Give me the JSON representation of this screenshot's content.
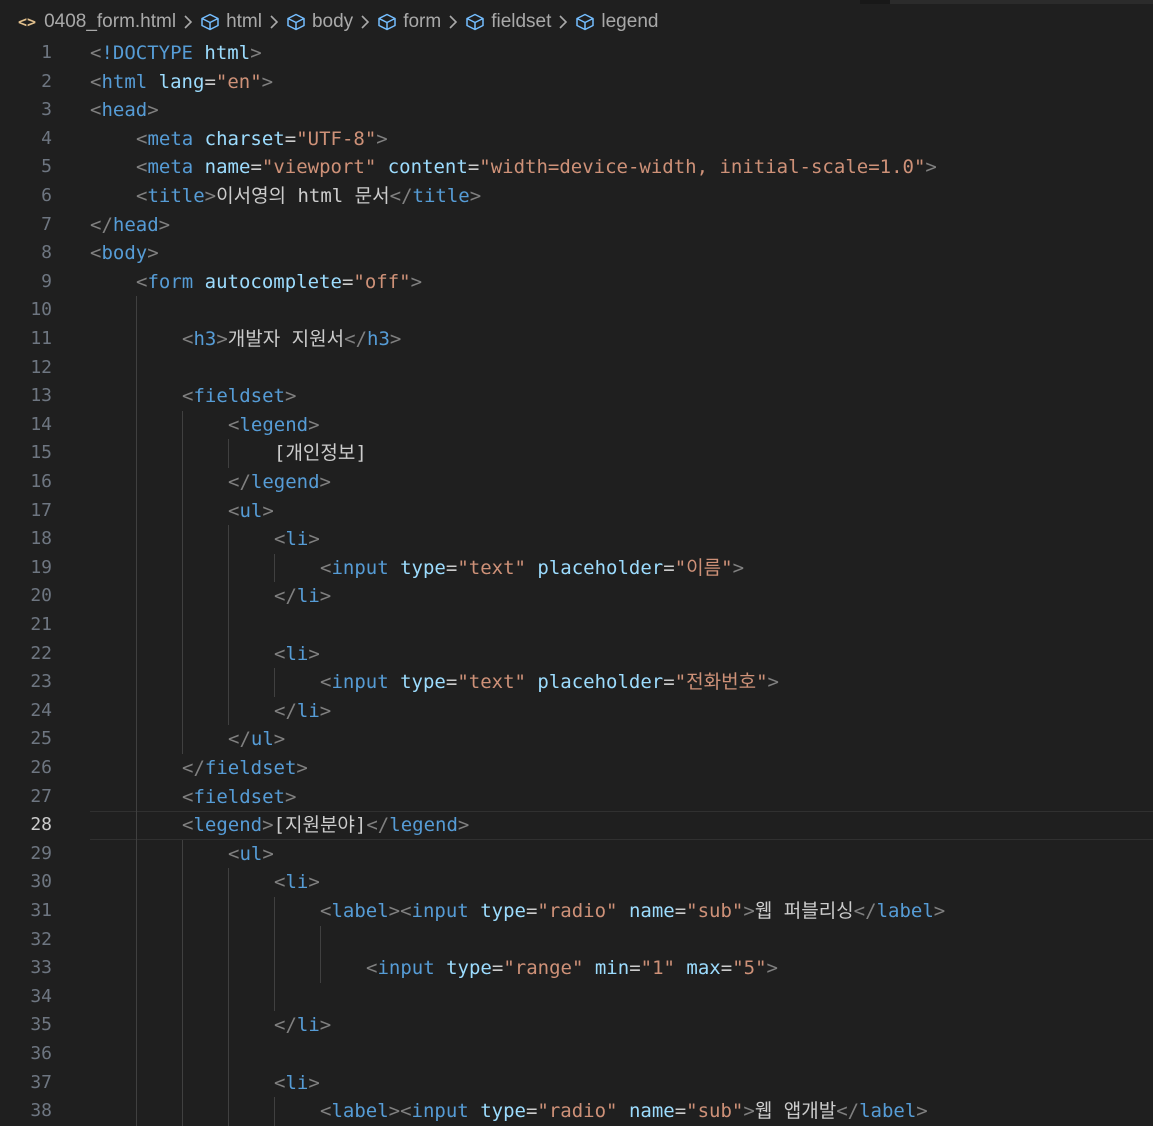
{
  "breadcrumb": {
    "file_icon": "<>",
    "file": "0408_form.html",
    "items": [
      "html",
      "body",
      "form",
      "fieldset",
      "legend"
    ]
  },
  "colors": {
    "background": "#1f1f1f",
    "tag": "#569cd6",
    "bracket": "#808080",
    "attribute": "#9cdcfe",
    "string": "#ce9178",
    "text": "#cccccc",
    "line_number": "#6e7681"
  },
  "editor": {
    "current_line": 28,
    "lines": [
      {
        "n": "1",
        "indent": 0,
        "tokens": [
          [
            "br",
            "<"
          ],
          [
            "tag",
            "!DOCTYPE"
          ],
          [
            "txt",
            " "
          ],
          [
            "attr",
            "html"
          ],
          [
            "br",
            ">"
          ]
        ]
      },
      {
        "n": "2",
        "indent": 0,
        "tokens": [
          [
            "br",
            "<"
          ],
          [
            "tag",
            "html"
          ],
          [
            "txt",
            " "
          ],
          [
            "attr",
            "lang"
          ],
          [
            "eq",
            "="
          ],
          [
            "val",
            "\"en\""
          ],
          [
            "br",
            ">"
          ]
        ]
      },
      {
        "n": "3",
        "indent": 0,
        "tokens": [
          [
            "br",
            "<"
          ],
          [
            "tag",
            "head"
          ],
          [
            "br",
            ">"
          ]
        ]
      },
      {
        "n": "4",
        "indent": 1,
        "tokens": [
          [
            "br",
            "<"
          ],
          [
            "tag",
            "meta"
          ],
          [
            "txt",
            " "
          ],
          [
            "attr",
            "charset"
          ],
          [
            "eq",
            "="
          ],
          [
            "val",
            "\"UTF-8\""
          ],
          [
            "br",
            ">"
          ]
        ]
      },
      {
        "n": "5",
        "indent": 1,
        "tokens": [
          [
            "br",
            "<"
          ],
          [
            "tag",
            "meta"
          ],
          [
            "txt",
            " "
          ],
          [
            "attr",
            "name"
          ],
          [
            "eq",
            "="
          ],
          [
            "val",
            "\"viewport\""
          ],
          [
            "txt",
            " "
          ],
          [
            "attr",
            "content"
          ],
          [
            "eq",
            "="
          ],
          [
            "val",
            "\"width=device-width, initial-scale=1.0\""
          ],
          [
            "br",
            ">"
          ]
        ]
      },
      {
        "n": "6",
        "indent": 1,
        "tokens": [
          [
            "br",
            "<"
          ],
          [
            "tag",
            "title"
          ],
          [
            "br",
            ">"
          ],
          [
            "txt",
            "이서영의 html 문서"
          ],
          [
            "br",
            "</"
          ],
          [
            "tag",
            "title"
          ],
          [
            "br",
            ">"
          ]
        ]
      },
      {
        "n": "7",
        "indent": 0,
        "tokens": [
          [
            "br",
            "</"
          ],
          [
            "tag",
            "head"
          ],
          [
            "br",
            ">"
          ]
        ]
      },
      {
        "n": "8",
        "indent": 0,
        "tokens": [
          [
            "br",
            "<"
          ],
          [
            "tag",
            "body"
          ],
          [
            "br",
            ">"
          ]
        ]
      },
      {
        "n": "9",
        "indent": 1,
        "tokens": [
          [
            "br",
            "<"
          ],
          [
            "tag",
            "form"
          ],
          [
            "txt",
            " "
          ],
          [
            "attr",
            "autocomplete"
          ],
          [
            "eq",
            "="
          ],
          [
            "val",
            "\"off\""
          ],
          [
            "br",
            ">"
          ]
        ]
      },
      {
        "n": "10",
        "indent": 2,
        "tokens": []
      },
      {
        "n": "11",
        "indent": 2,
        "tokens": [
          [
            "br",
            "<"
          ],
          [
            "tag",
            "h3"
          ],
          [
            "br",
            ">"
          ],
          [
            "txt",
            "개발자 지원서"
          ],
          [
            "br",
            "</"
          ],
          [
            "tag",
            "h3"
          ],
          [
            "br",
            ">"
          ]
        ]
      },
      {
        "n": "12",
        "indent": 2,
        "tokens": []
      },
      {
        "n": "13",
        "indent": 2,
        "tokens": [
          [
            "br",
            "<"
          ],
          [
            "tag",
            "fieldset"
          ],
          [
            "br",
            ">"
          ]
        ]
      },
      {
        "n": "14",
        "indent": 3,
        "tokens": [
          [
            "br",
            "<"
          ],
          [
            "tag",
            "legend"
          ],
          [
            "br",
            ">"
          ]
        ]
      },
      {
        "n": "15",
        "indent": 4,
        "tokens": [
          [
            "txt",
            "[개인정보]"
          ]
        ]
      },
      {
        "n": "16",
        "indent": 3,
        "tokens": [
          [
            "br",
            "</"
          ],
          [
            "tag",
            "legend"
          ],
          [
            "br",
            ">"
          ]
        ]
      },
      {
        "n": "17",
        "indent": 3,
        "tokens": [
          [
            "br",
            "<"
          ],
          [
            "tag",
            "ul"
          ],
          [
            "br",
            ">"
          ]
        ]
      },
      {
        "n": "18",
        "indent": 4,
        "tokens": [
          [
            "br",
            "<"
          ],
          [
            "tag",
            "li"
          ],
          [
            "br",
            ">"
          ]
        ]
      },
      {
        "n": "19",
        "indent": 5,
        "tokens": [
          [
            "br",
            "<"
          ],
          [
            "tag",
            "input"
          ],
          [
            "txt",
            " "
          ],
          [
            "attr",
            "type"
          ],
          [
            "eq",
            "="
          ],
          [
            "val",
            "\"text\""
          ],
          [
            "txt",
            " "
          ],
          [
            "attr",
            "placeholder"
          ],
          [
            "eq",
            "="
          ],
          [
            "val",
            "\"이름\""
          ],
          [
            "br",
            ">"
          ]
        ]
      },
      {
        "n": "20",
        "indent": 4,
        "tokens": [
          [
            "br",
            "</"
          ],
          [
            "tag",
            "li"
          ],
          [
            "br",
            ">"
          ]
        ]
      },
      {
        "n": "21",
        "indent": 4,
        "tokens": []
      },
      {
        "n": "22",
        "indent": 4,
        "tokens": [
          [
            "br",
            "<"
          ],
          [
            "tag",
            "li"
          ],
          [
            "br",
            ">"
          ]
        ]
      },
      {
        "n": "23",
        "indent": 5,
        "tokens": [
          [
            "br",
            "<"
          ],
          [
            "tag",
            "input"
          ],
          [
            "txt",
            " "
          ],
          [
            "attr",
            "type"
          ],
          [
            "eq",
            "="
          ],
          [
            "val",
            "\"text\""
          ],
          [
            "txt",
            " "
          ],
          [
            "attr",
            "placeholder"
          ],
          [
            "eq",
            "="
          ],
          [
            "val",
            "\"전화번호\""
          ],
          [
            "br",
            ">"
          ]
        ]
      },
      {
        "n": "24",
        "indent": 4,
        "tokens": [
          [
            "br",
            "</"
          ],
          [
            "tag",
            "li"
          ],
          [
            "br",
            ">"
          ]
        ]
      },
      {
        "n": "25",
        "indent": 3,
        "tokens": [
          [
            "br",
            "</"
          ],
          [
            "tag",
            "ul"
          ],
          [
            "br",
            ">"
          ]
        ]
      },
      {
        "n": "26",
        "indent": 2,
        "tokens": [
          [
            "br",
            "</"
          ],
          [
            "tag",
            "fieldset"
          ],
          [
            "br",
            ">"
          ]
        ]
      },
      {
        "n": "27",
        "indent": 2,
        "tokens": [
          [
            "br",
            "<"
          ],
          [
            "tag",
            "fieldset"
          ],
          [
            "br",
            ">"
          ]
        ]
      },
      {
        "n": "28",
        "indent": 2,
        "tokens": [
          [
            "br",
            "<"
          ],
          [
            "tag",
            "legend"
          ],
          [
            "br",
            ">"
          ],
          [
            "txt",
            "[지원분야]"
          ],
          [
            "br",
            "</"
          ],
          [
            "tag",
            "legend"
          ],
          [
            "br",
            ">"
          ]
        ]
      },
      {
        "n": "29",
        "indent": 3,
        "tokens": [
          [
            "br",
            "<"
          ],
          [
            "tag",
            "ul"
          ],
          [
            "br",
            ">"
          ]
        ]
      },
      {
        "n": "30",
        "indent": 4,
        "tokens": [
          [
            "br",
            "<"
          ],
          [
            "tag",
            "li"
          ],
          [
            "br",
            ">"
          ]
        ]
      },
      {
        "n": "31",
        "indent": 5,
        "tokens": [
          [
            "br",
            "<"
          ],
          [
            "tag",
            "label"
          ],
          [
            "br",
            "><"
          ],
          [
            "tag",
            "input"
          ],
          [
            "txt",
            " "
          ],
          [
            "attr",
            "type"
          ],
          [
            "eq",
            "="
          ],
          [
            "val",
            "\"radio\""
          ],
          [
            "txt",
            " "
          ],
          [
            "attr",
            "name"
          ],
          [
            "eq",
            "="
          ],
          [
            "val",
            "\"sub\""
          ],
          [
            "br",
            ">"
          ],
          [
            "txt",
            "웹 퍼블리싱"
          ],
          [
            "br",
            "</"
          ],
          [
            "tag",
            "label"
          ],
          [
            "br",
            ">"
          ]
        ]
      },
      {
        "n": "32",
        "indent": 6,
        "tokens": []
      },
      {
        "n": "33",
        "indent": 6,
        "tokens": [
          [
            "br",
            "<"
          ],
          [
            "tag",
            "input"
          ],
          [
            "txt",
            " "
          ],
          [
            "attr",
            "type"
          ],
          [
            "eq",
            "="
          ],
          [
            "val",
            "\"range\""
          ],
          [
            "txt",
            " "
          ],
          [
            "attr",
            "min"
          ],
          [
            "eq",
            "="
          ],
          [
            "val",
            "\"1\""
          ],
          [
            "txt",
            " "
          ],
          [
            "attr",
            "max"
          ],
          [
            "eq",
            "="
          ],
          [
            "val",
            "\"5\""
          ],
          [
            "br",
            ">"
          ]
        ]
      },
      {
        "n": "34",
        "indent": 5,
        "tokens": []
      },
      {
        "n": "35",
        "indent": 4,
        "tokens": [
          [
            "br",
            "</"
          ],
          [
            "tag",
            "li"
          ],
          [
            "br",
            ">"
          ]
        ]
      },
      {
        "n": "36",
        "indent": 4,
        "tokens": []
      },
      {
        "n": "37",
        "indent": 4,
        "tokens": [
          [
            "br",
            "<"
          ],
          [
            "tag",
            "li"
          ],
          [
            "br",
            ">"
          ]
        ]
      },
      {
        "n": "38",
        "indent": 5,
        "tokens": [
          [
            "br",
            "<"
          ],
          [
            "tag",
            "label"
          ],
          [
            "br",
            "><"
          ],
          [
            "tag",
            "input"
          ],
          [
            "txt",
            " "
          ],
          [
            "attr",
            "type"
          ],
          [
            "eq",
            "="
          ],
          [
            "val",
            "\"radio\""
          ],
          [
            "txt",
            " "
          ],
          [
            "attr",
            "name"
          ],
          [
            "eq",
            "="
          ],
          [
            "val",
            "\"sub\""
          ],
          [
            "br",
            ">"
          ],
          [
            "txt",
            "웹 앱개발"
          ],
          [
            "br",
            "</"
          ],
          [
            "tag",
            "label"
          ],
          [
            "br",
            ">"
          ]
        ]
      }
    ]
  }
}
